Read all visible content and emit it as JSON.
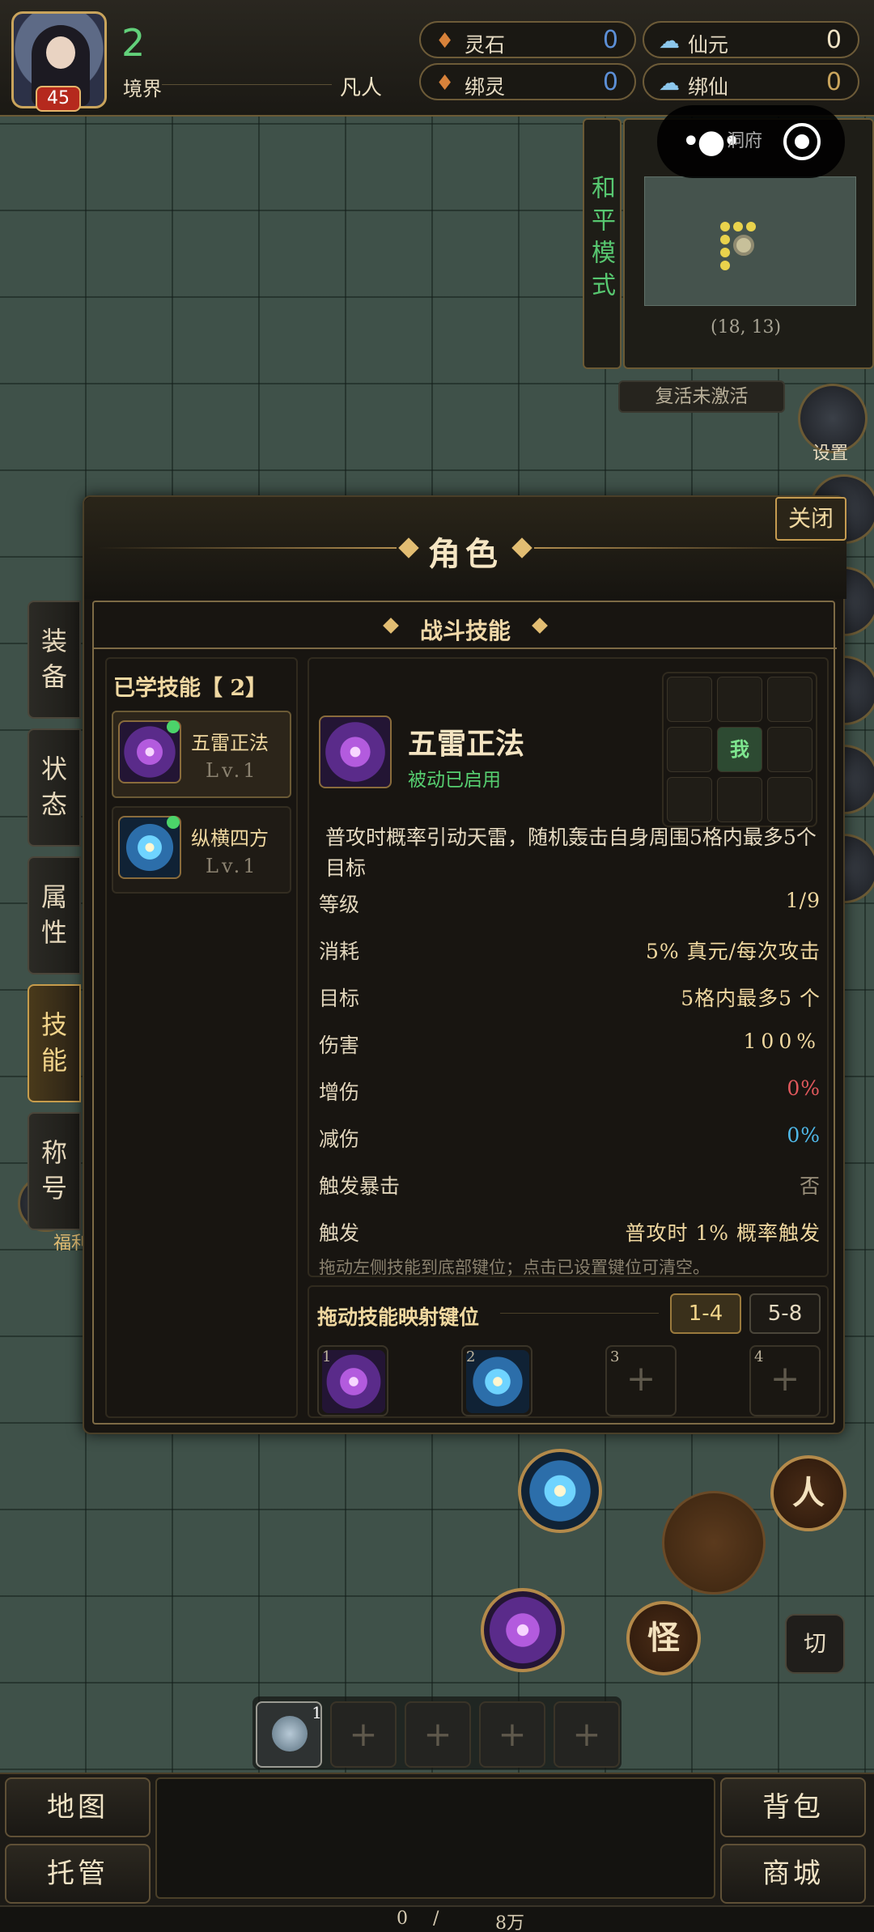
{
  "player": {
    "num": "2",
    "level": "45",
    "realm_label": "境界",
    "realm_value": "凡人"
  },
  "resources": [
    {
      "label": "灵石",
      "value": "0",
      "color": "#5c8fd6"
    },
    {
      "label": "仙元",
      "value": "0",
      "color": "#f0e3c5"
    },
    {
      "label": "绑灵",
      "value": "0",
      "color": "#5c8fd6"
    },
    {
      "label": "绑仙",
      "value": "0",
      "color": "#c9a45c"
    }
  ],
  "minimap": {
    "mode": "和平模式",
    "title": "洞府",
    "coords": "(18, 13)",
    "revive": "复活未激活",
    "settings": "设置"
  },
  "panel": {
    "title": "角色",
    "close": "关闭",
    "section": "战斗技能"
  },
  "tabs": [
    "装备",
    "状态",
    "属性",
    "技能",
    "称号"
  ],
  "active_tab": 3,
  "welfare": "福利",
  "learned": {
    "title": "已学技能【 2】",
    "items": [
      {
        "name": "五雷正法",
        "level": "Lv.1"
      },
      {
        "name": "纵横四方",
        "level": "Lv.1"
      }
    ]
  },
  "detail": {
    "name": "五雷正法",
    "status": "被动已启用",
    "grid_me": "我",
    "desc": "普攻时概率引动天雷，随机轰击自身周围5格内最多5个目标",
    "rows": [
      {
        "k": "等级",
        "v": "1/9",
        "color": "#f0d8a0"
      },
      {
        "k": "消耗",
        "v": "5% 真元/每次攻击",
        "color": "#f0d8a0"
      },
      {
        "k": "目标",
        "v": "5格内最多5 个",
        "color": "#f0d8a0"
      },
      {
        "k": "伤害",
        "v": "100%",
        "color": "#f0d8a0"
      },
      {
        "k": "增伤",
        "v": "0%",
        "color": "#e0585c"
      },
      {
        "k": "减伤",
        "v": "0%",
        "color": "#4fb8e8"
      },
      {
        "k": "触发暴击",
        "v": "否",
        "color": "#9a907b"
      },
      {
        "k": "触发",
        "v": "普攻时 1% 概率触发",
        "color": "#f0d8a0"
      }
    ],
    "hint": "拖动左侧技能到底部键位；点击已设置键位可清空。"
  },
  "keybind": {
    "title": "拖动技能映射键位",
    "tabs": [
      "1-4",
      "5-8"
    ],
    "active_tab": 0,
    "slots": [
      {
        "num": "1",
        "skill": "thunder"
      },
      {
        "num": "2",
        "skill": "compass"
      },
      {
        "num": "3",
        "skill": ""
      },
      {
        "num": "4",
        "skill": ""
      }
    ]
  },
  "field": {
    "person_btn": "人",
    "monster_btn": "怪",
    "switch_btn": "切"
  },
  "quickbar": {
    "first_count": "1",
    "plus": "+"
  },
  "bottom": {
    "map": "地图",
    "auto": "托管",
    "bag": "背包",
    "shop": "商城",
    "exp_current": "0",
    "exp_sep": "/",
    "exp_max": "8万"
  }
}
